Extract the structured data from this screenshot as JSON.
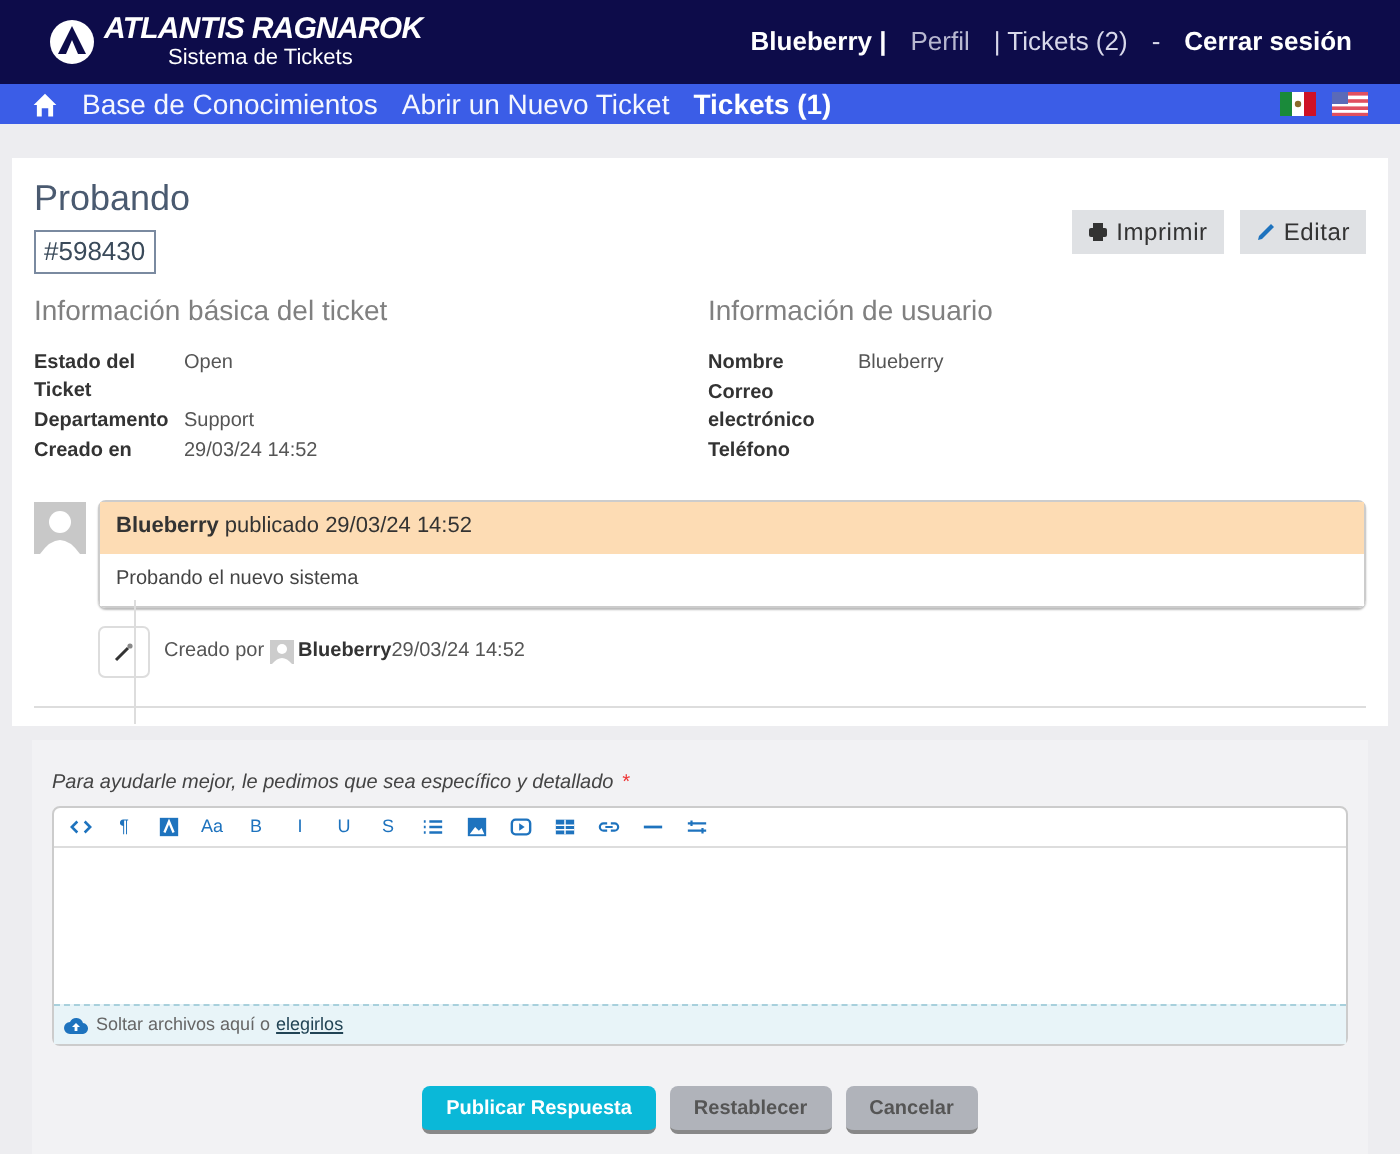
{
  "header": {
    "brand": "ATLANTIS RAGNAROK",
    "subtitle": "Sistema de Tickets",
    "user_links": [
      {
        "label": "Blueberry |",
        "kind": "bold"
      },
      {
        "label": "Perfil",
        "kind": "muted"
      },
      {
        "label": "| Tickets (2)",
        "kind": "normal"
      },
      {
        "label": "-",
        "kind": "normal"
      },
      {
        "label": "Cerrar sesión",
        "kind": "bold"
      }
    ]
  },
  "nav": {
    "items": [
      {
        "label": "Base de Conocimientos",
        "selected": false
      },
      {
        "label": "Abrir un Nuevo Ticket",
        "selected": false
      },
      {
        "label": "Tickets (1)",
        "selected": true
      }
    ]
  },
  "ticket": {
    "title": "Probando",
    "number": "#598430",
    "actions": [
      {
        "label": "Imprimir",
        "kind": "print"
      },
      {
        "label": "Editar",
        "kind": "edit"
      }
    ],
    "basic_info": {
      "heading": "Información básica del ticket",
      "fields": [
        {
          "label": "Estado del Ticket",
          "value": "Open"
        },
        {
          "label": "Departamento",
          "value": "Support"
        },
        {
          "label": "Creado en",
          "value": "29/03/24 14:52"
        }
      ]
    },
    "user_info": {
      "heading": "Información de usuario",
      "fields": [
        {
          "label": "Nombre",
          "value": "Blueberry"
        },
        {
          "label": "Correo electrónico"
        },
        {
          "label": "Teléfono"
        }
      ]
    }
  },
  "thread": {
    "message": {
      "author": "Blueberry",
      "meta": "publicado 29/03/24 14:52",
      "body": "Probando el nuevo sistema"
    },
    "event": {
      "prefix": "Creado por",
      "author": "Blueberry",
      "time": "29/03/24 14:52"
    }
  },
  "reply": {
    "label": "Para ayudarle mejor, le pedimos que sea específico y detallado",
    "required_mark": "*",
    "toolbar": [
      {
        "kind": "code"
      },
      {
        "kind": "char",
        "char": "¶"
      },
      {
        "kind": "font-color"
      },
      {
        "kind": "char",
        "char": "Aa"
      },
      {
        "kind": "char",
        "char": "B"
      },
      {
        "kind": "char",
        "char": "I"
      },
      {
        "kind": "char",
        "char": "U"
      },
      {
        "kind": "char",
        "char": "S"
      },
      {
        "kind": "list"
      },
      {
        "kind": "image"
      },
      {
        "kind": "video"
      },
      {
        "kind": "table"
      },
      {
        "kind": "link"
      },
      {
        "kind": "rule"
      },
      {
        "kind": "more"
      }
    ],
    "dropzone": {
      "text": "Soltar archivos aquí o",
      "link": "elegirlos"
    },
    "buttons": [
      {
        "label": "Publicar Respuesta",
        "kind": "primary"
      },
      {
        "label": "Restablecer",
        "kind": "secondary"
      },
      {
        "label": "Cancelar",
        "kind": "secondary"
      }
    ]
  }
}
